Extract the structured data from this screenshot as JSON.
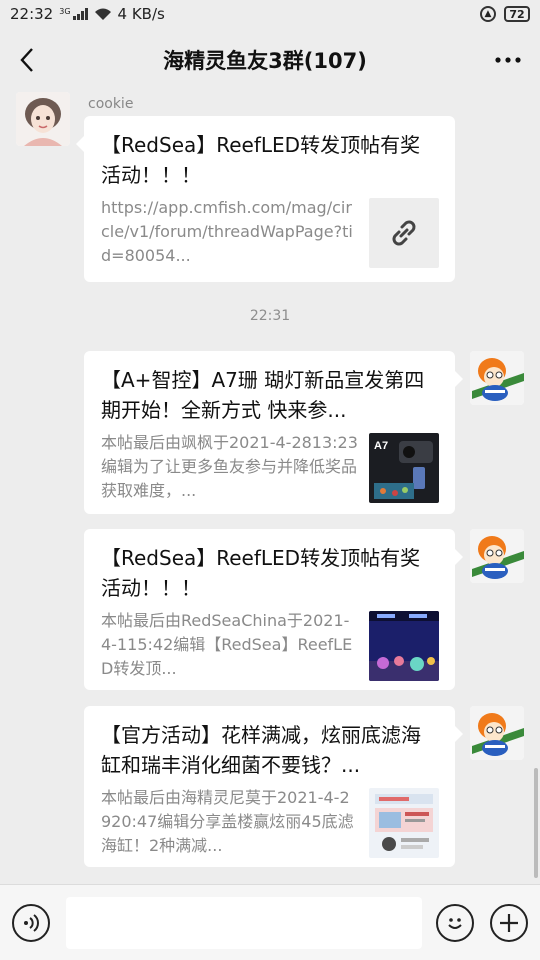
{
  "status": {
    "time": "22:32",
    "network": "3G",
    "speed": "4 KB/s",
    "battery": "72"
  },
  "header": {
    "title": "海精灵鱼友3群(107)"
  },
  "messages": [
    {
      "sender": "cookie",
      "title": "【RedSea】ReefLED转发顶帖有奖活动！！！",
      "desc": "https://app.cmfish.com/mag/circle/v1/forum/threadWapPage?tid=80054...",
      "thumb_icon": "link-icon"
    },
    {
      "title": "【A+智控】A7珊 瑚灯新品宣发第四期开始！全新方式  快来参...",
      "desc": "本帖最后由飒枫于2021-4-2813:23编辑为了让更多鱼友参与并降低奖品获取难度，...",
      "thumb_label": "A7"
    },
    {
      "title": "【RedSea】ReefLED转发顶帖有奖活动！！！",
      "desc": "本帖最后由RedSeaChina于2021-4-115:42编辑【RedSea】ReefLED转发顶..."
    },
    {
      "title": "【官方活动】花样满减，炫丽底滤海缸和瑞丰消化细菌不要钱？...",
      "desc": "本帖最后由海精灵尼莫于2021-4-2920:47编辑分享盖楼赢炫丽45底滤海缸！2种满减..."
    }
  ],
  "divider_time": "22:31",
  "colors": {
    "background": "#ededed",
    "card": "#ffffff",
    "muted_text": "#8a8a8a"
  }
}
